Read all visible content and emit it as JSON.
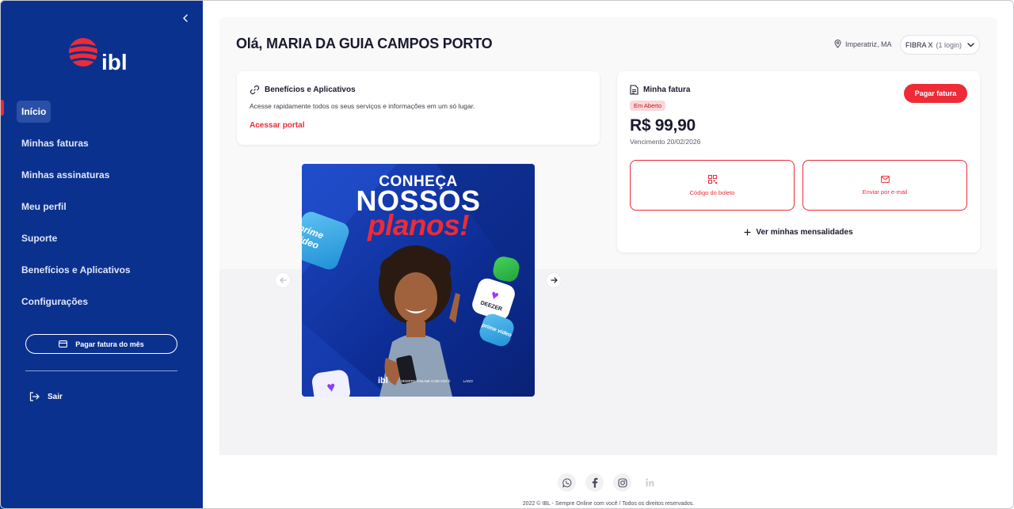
{
  "brand": {
    "logo_text": "ibl",
    "accent": "#ee2b36",
    "sidebar_bg": "#0b318f"
  },
  "sidebar": {
    "items": [
      {
        "label": "Início",
        "active": true
      },
      {
        "label": "Minhas faturas"
      },
      {
        "label": "Minhas assinaturas"
      },
      {
        "label": "Meu perfil"
      },
      {
        "label": "Suporte"
      },
      {
        "label": "Benefícios e Aplicativos"
      },
      {
        "label": "Configurações"
      }
    ],
    "pay_month_label": "Pagar fatura do mês",
    "logout_label": "Sair"
  },
  "header": {
    "greeting": "Olá, MARIA DA GUIA CAMPOS PORTO",
    "location": "Imperatriz, MA",
    "plan_name": "FIBRA X",
    "plan_detail": "(1 login)"
  },
  "benefits": {
    "title": "Benefícios e Aplicativos",
    "description": "Acesse rapidamente todos os seus serviços e informações em um só lugar.",
    "link": "Acessar portal"
  },
  "invoice": {
    "title": "Minha fatura",
    "status": "Em Aberto",
    "amount": "R$ 99,90",
    "due": "Vencimento 20/02/2026",
    "pay_label": "Pagar fatura",
    "barcode_label": "Código do boleto",
    "email_label": "Enviar por e-mail",
    "more_label": "Ver minhas mensalidades"
  },
  "banner": {
    "line1": "CONHEÇA",
    "line2": "NOSSOS",
    "line3": "planos!",
    "tile_prime": "prime video",
    "tile_deezer": "DEEZER",
    "tile_prime2": "prime video",
    "footer_logo": "ibl",
    "footer_tagline": "SEMPRE ONLINE COM VOCÊ",
    "footer_tagline2": "LADO"
  },
  "footer": {
    "socials": [
      "whatsapp-icon",
      "facebook-icon",
      "instagram-icon",
      "linkedin-icon"
    ],
    "copyright": "2022 © IBL - Sempre Online com você / Todos os direitos reservados."
  }
}
